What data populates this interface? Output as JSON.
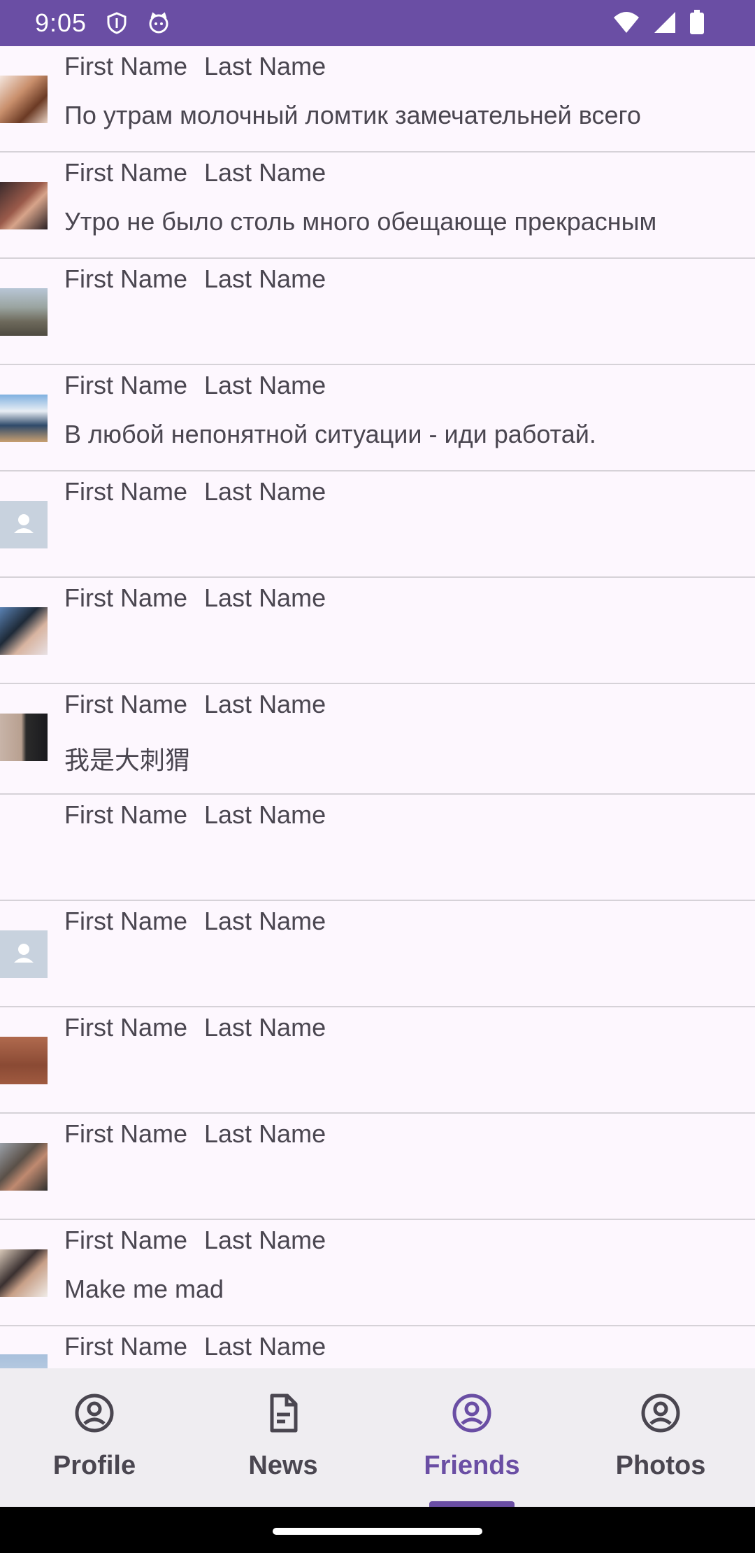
{
  "status_bar": {
    "time": "9:05",
    "icons": [
      "shield-icon",
      "cat-face-icon",
      "wifi-icon",
      "signal-icon",
      "battery-icon"
    ],
    "background": "#6a4ea4"
  },
  "friends": [
    {
      "first_name": "First Name",
      "last_name": "Last Name",
      "status": "По утрам молочный ломтик замечательней всего",
      "avatar": "photo-woman-brown-hair"
    },
    {
      "first_name": "First Name",
      "last_name": "Last Name",
      "status": "Утро не было столь много обещающе прекрасным",
      "avatar": "photo-woman-dark"
    },
    {
      "first_name": "First Name",
      "last_name": "Last Name",
      "status": "",
      "avatar": "photo-mountain-man"
    },
    {
      "first_name": "First Name",
      "last_name": "Last Name",
      "status": "В любой непонятной ситуации - иди работай.",
      "avatar": "photo-snow-mountain"
    },
    {
      "first_name": "First Name",
      "last_name": "Last Name",
      "status": "",
      "avatar": "default-person-placeholder"
    },
    {
      "first_name": "First Name",
      "last_name": "Last Name",
      "status": "",
      "avatar": "photo-couple"
    },
    {
      "first_name": "First Name",
      "last_name": "Last Name",
      "status": "我是大刺猬",
      "avatar": "photo-man-balloons"
    },
    {
      "first_name": "First Name",
      "last_name": "Last Name",
      "status": "",
      "avatar": "none"
    },
    {
      "first_name": "First Name",
      "last_name": "Last Name",
      "status": "",
      "avatar": "default-person-placeholder"
    },
    {
      "first_name": "First Name",
      "last_name": "Last Name",
      "status": "",
      "avatar": "photo-bear"
    },
    {
      "first_name": "First Name",
      "last_name": "Last Name",
      "status": "",
      "avatar": "photo-man-car"
    },
    {
      "first_name": "First Name",
      "last_name": "Last Name",
      "status": "Make me mad",
      "avatar": "photo-group"
    },
    {
      "first_name": "First Name",
      "last_name": "Last Name",
      "status": "",
      "avatar": "photo-partial"
    }
  ],
  "bottom_nav": {
    "items": [
      {
        "label": "Profile",
        "icon": "account-circle-icon",
        "active": false
      },
      {
        "label": "News",
        "icon": "document-icon",
        "active": false
      },
      {
        "label": "Friends",
        "icon": "account-circle-icon",
        "active": true
      },
      {
        "label": "Photos",
        "icon": "account-circle-icon",
        "active": false
      }
    ],
    "active_color": "#6a4ea4",
    "inactive_color": "#4a4650"
  }
}
